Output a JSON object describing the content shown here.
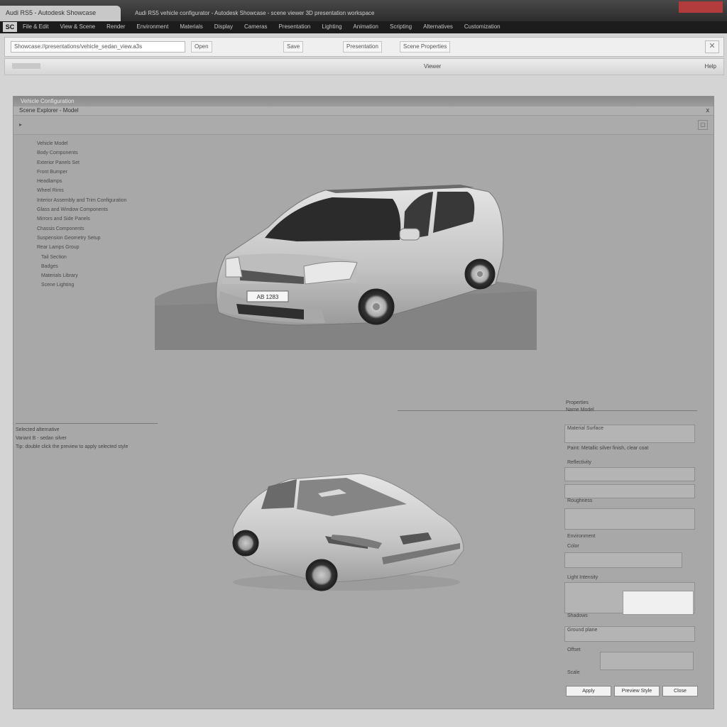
{
  "window": {
    "tab_title": "Audi RS5 - Autodesk Showcase",
    "title_text": "Audi RS5 vehicle configurator - Autodesk Showcase - scene viewer 3D presentation workspace"
  },
  "menu": {
    "logo": "SC",
    "items": [
      "File & Edit",
      "View & Scene",
      "Render",
      "Environment",
      "Materials",
      "Display",
      "Cameras",
      "Presentation",
      "Lighting",
      "Animation",
      "Scripting",
      "Alternatives",
      "Customization"
    ]
  },
  "address": {
    "url": "Showcase://presentations/vehicle_sedan_view.a3s",
    "buttons": [
      "Open",
      "Save",
      "Presentation",
      "Scene Properties"
    ]
  },
  "toolbar": {
    "center": "Viewer",
    "right": "Help"
  },
  "inner": {
    "header": "Vehicle Configuration",
    "subheader": "Scene Explorer - Model",
    "close": "x"
  },
  "tree_items": [
    "Vehicle Model",
    "Body Components",
    "Exterior Panels Set",
    "Front Bumper",
    "Headlamps",
    "Wheel Rims",
    "Interior Assembly and Trim Configuration",
    "Glass and Window Components",
    "Mirrors and Side Panels",
    "Chassis Components",
    "Suspension Geometry Setup",
    "Rear Lamps Group",
    "Tail Section",
    "Badges",
    "Materials Library",
    "Scene Lighting"
  ],
  "plate_text": "AB 1283",
  "left_info": [
    "Selected alternative",
    "Variant B - sedan silver",
    "Tip: double click the preview to apply selected style"
  ],
  "right_panel": {
    "labels": [
      "Properties",
      "Name  Model",
      "Material Surface",
      "Paint: Metallic silver finish, clear coat",
      "Reflectivity",
      "Roughness",
      "Environment",
      "Color",
      "Light Intensity",
      "Shadows",
      "Ground plane",
      "Offset",
      "Scale"
    ]
  },
  "buttons": {
    "ok": "Apply",
    "cancel": "Preview Style",
    "close": "Close"
  },
  "colors": {
    "titlebar": "#2c2c2c",
    "close": "#b23c3c",
    "workspace": "#a8a8a8",
    "car_body": "#c9c9c9"
  }
}
